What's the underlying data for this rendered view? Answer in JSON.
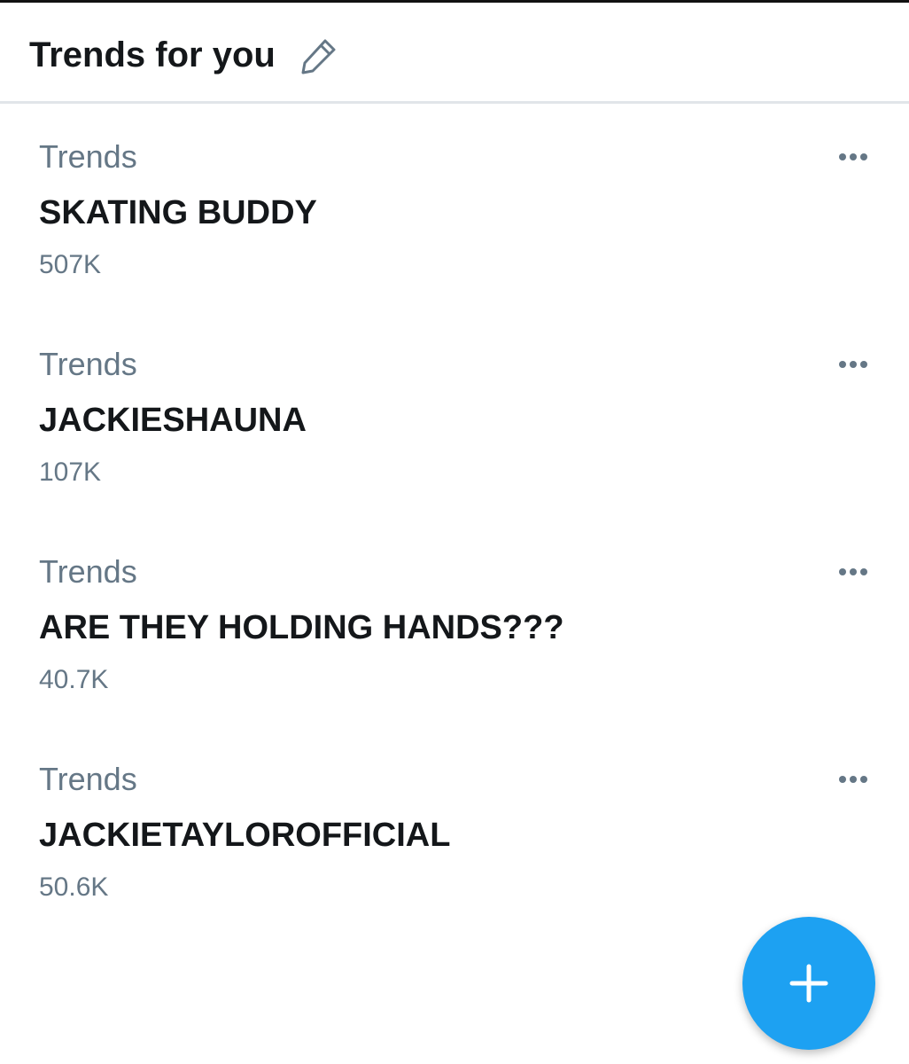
{
  "header": {
    "title": "Trends for you",
    "edit_icon": "pencil-icon"
  },
  "trends": [
    {
      "category": "Trends",
      "name": "SKATING BUDDY",
      "count": "507K"
    },
    {
      "category": "Trends",
      "name": "JACKIESHAUNA",
      "count": "107K"
    },
    {
      "category": "Trends",
      "name": "ARE THEY HOLDING HANDS???",
      "count": "40.7K"
    },
    {
      "category": "Trends",
      "name": "JACKIETAYLOROFFICIAL",
      "count": "50.6K"
    }
  ],
  "more_icon": "more-horizontal-icon",
  "fab": {
    "icon": "plus-icon",
    "color": "#1da1f2"
  },
  "colors": {
    "primary_text": "#14171a",
    "secondary_text": "#657786",
    "divider": "#e1e5e9"
  }
}
